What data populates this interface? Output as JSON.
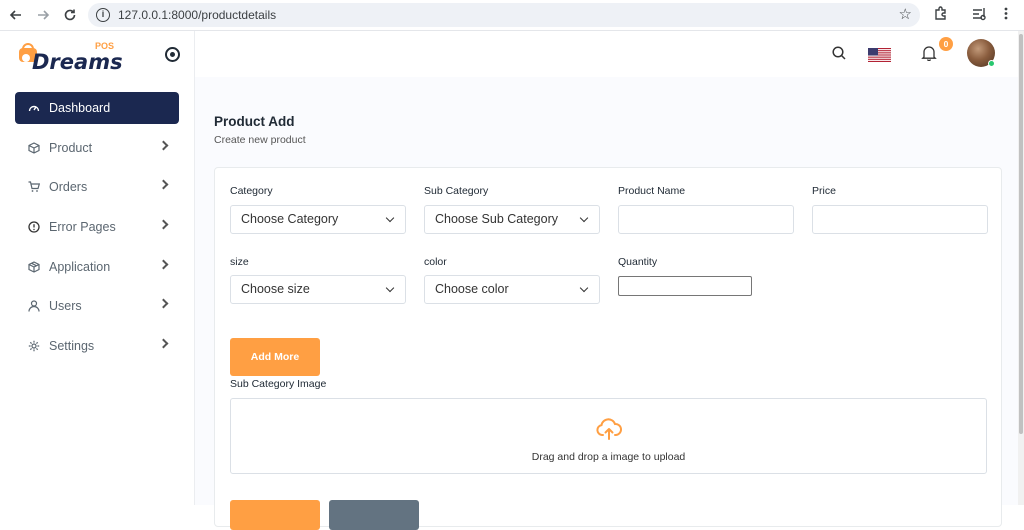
{
  "browser": {
    "url": "127.0.0.1:8000/productdetails"
  },
  "logo": {
    "text": "Dreams",
    "tag": "POS",
    "color": "#ff9f43"
  },
  "sidebar": {
    "items": [
      {
        "label": "Dashboard",
        "icon": "dashboard-icon",
        "active": true
      },
      {
        "label": "Product",
        "icon": "box-icon"
      },
      {
        "label": "Orders",
        "icon": "cart-icon"
      },
      {
        "label": "Error Pages",
        "icon": "alert-circle-icon"
      },
      {
        "label": "Application",
        "icon": "package-icon"
      },
      {
        "label": "Users",
        "icon": "user-icon"
      },
      {
        "label": "Settings",
        "icon": "gear-icon"
      }
    ]
  },
  "header": {
    "notification_count": "0"
  },
  "page": {
    "title": "Product Add",
    "subtitle": "Create new product"
  },
  "form": {
    "category_label": "Category",
    "category_value": "Choose Category",
    "subcategory_label": "Sub Category",
    "subcategory_value": "Choose Sub Category",
    "product_name_label": "Product Name",
    "price_label": "Price",
    "size_label": "size",
    "size_value": "Choose size",
    "color_label": "color",
    "color_value": "Choose color",
    "quantity_label": "Quantity",
    "add_more_label": "Add More",
    "subcat_image_label": "Sub Category Image",
    "upload_text": "Drag and drop a image to upload"
  },
  "colors": {
    "accent": "#ff9f43",
    "sidebar_active": "#1b2850",
    "secondary": "#637381"
  }
}
